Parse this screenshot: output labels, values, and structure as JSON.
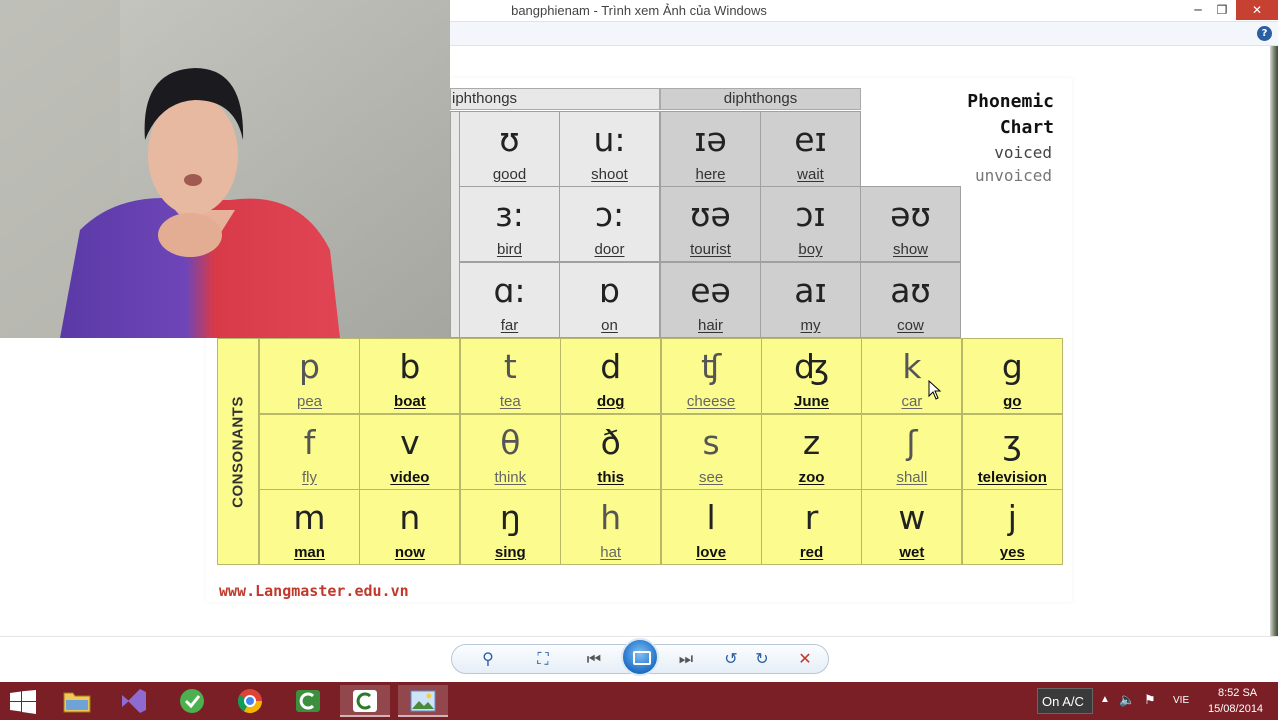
{
  "window": {
    "title": "bangphienam - Trình xem Ảnh của Windows",
    "minimize_glyph": "─",
    "restore_glyph": "❐",
    "close_glyph": "✕",
    "help_glyph": "?"
  },
  "chart": {
    "legend_title_1": "Phonemic",
    "legend_title_2": "Chart",
    "legend_voiced": "voiced",
    "legend_unvoiced": "unvoiced",
    "header_left": "iphthongs",
    "header_right": "diphthongs",
    "consonants_label": "CONSONANTS",
    "website": "www.Langmaster.edu.vn",
    "vowels": [
      {
        "symbol": "ʊ",
        "word": "good"
      },
      {
        "symbol": "u:",
        "word": "shoot"
      },
      {
        "symbol": "ɜ:",
        "word": "bird"
      },
      {
        "symbol": "ɔ:",
        "word": "door"
      },
      {
        "symbol": "ɑ:",
        "word": "far"
      },
      {
        "symbol": "ɒ",
        "word": "on"
      }
    ],
    "diphthongs": [
      {
        "symbol": "ɪə",
        "word": "here"
      },
      {
        "symbol": "eɪ",
        "word": "wait"
      },
      {
        "symbol": "ʊə",
        "word": "tourist"
      },
      {
        "symbol": "ɔɪ",
        "word": "boy"
      },
      {
        "symbol": "əʊ",
        "word": "show"
      },
      {
        "symbol": "eə",
        "word": "hair"
      },
      {
        "symbol": "aɪ",
        "word": "my"
      },
      {
        "symbol": "aʊ",
        "word": "cow"
      }
    ],
    "consonants": [
      {
        "symbol": "p",
        "word": "pea",
        "voiced": false
      },
      {
        "symbol": "b",
        "word": "boat",
        "voiced": true
      },
      {
        "symbol": "t",
        "word": "tea",
        "voiced": false
      },
      {
        "symbol": "d",
        "word": "dog",
        "voiced": true
      },
      {
        "symbol": "ʧ",
        "word": "cheese",
        "voiced": false
      },
      {
        "symbol": "ʤ",
        "word": "June",
        "voiced": true
      },
      {
        "symbol": "k",
        "word": "car",
        "voiced": false
      },
      {
        "symbol": "g",
        "word": "go",
        "voiced": true
      },
      {
        "symbol": "f",
        "word": "fly",
        "voiced": false
      },
      {
        "symbol": "v",
        "word": "video",
        "voiced": true
      },
      {
        "symbol": "θ",
        "word": "think",
        "voiced": false
      },
      {
        "symbol": "ð",
        "word": "this",
        "voiced": true
      },
      {
        "symbol": "s",
        "word": "see",
        "voiced": false
      },
      {
        "symbol": "z",
        "word": "zoo",
        "voiced": true
      },
      {
        "symbol": "ʃ",
        "word": "shall",
        "voiced": false
      },
      {
        "symbol": "ʒ",
        "word": "television",
        "voiced": true
      },
      {
        "symbol": "m",
        "word": "man",
        "voiced": true
      },
      {
        "symbol": "n",
        "word": "now",
        "voiced": true
      },
      {
        "symbol": "ŋ",
        "word": "sing",
        "voiced": true
      },
      {
        "symbol": "h",
        "word": "hat",
        "voiced": false
      },
      {
        "symbol": "l",
        "word": "love",
        "voiced": true
      },
      {
        "symbol": "r",
        "word": "red",
        "voiced": true
      },
      {
        "symbol": "w",
        "word": "wet",
        "voiced": true
      },
      {
        "symbol": "j",
        "word": "yes",
        "voiced": true
      }
    ]
  },
  "toolbar": {
    "zoom_glyph": "⚲",
    "fit_glyph": "⛶",
    "prev_glyph": "⏮",
    "next_glyph": "⏭",
    "rotate_left_glyph": "↺",
    "rotate_right_glyph": "↻",
    "delete_glyph": "✕"
  },
  "taskbar": {
    "apps": [
      "windows-start",
      "file-explorer",
      "visual-studio",
      "coccoc-browser",
      "chrome",
      "camtasia-recorder",
      "camtasia-studio",
      "photo-viewer"
    ],
    "power_label": "On A/C",
    "language": "VIE",
    "time": "8:52 SA",
    "date": "15/08/2014",
    "tray_arrow_glyph": "▲",
    "volume_glyph": "🔈",
    "network_glyph": "⚑"
  },
  "colors": {
    "consonant_bg": "#fbfb8e",
    "diphthong_bg": "#cfcfcf",
    "vowel_bg": "#e9e9e9",
    "taskbar_bg": "#7a1f26",
    "website_color": "#c0392b"
  }
}
